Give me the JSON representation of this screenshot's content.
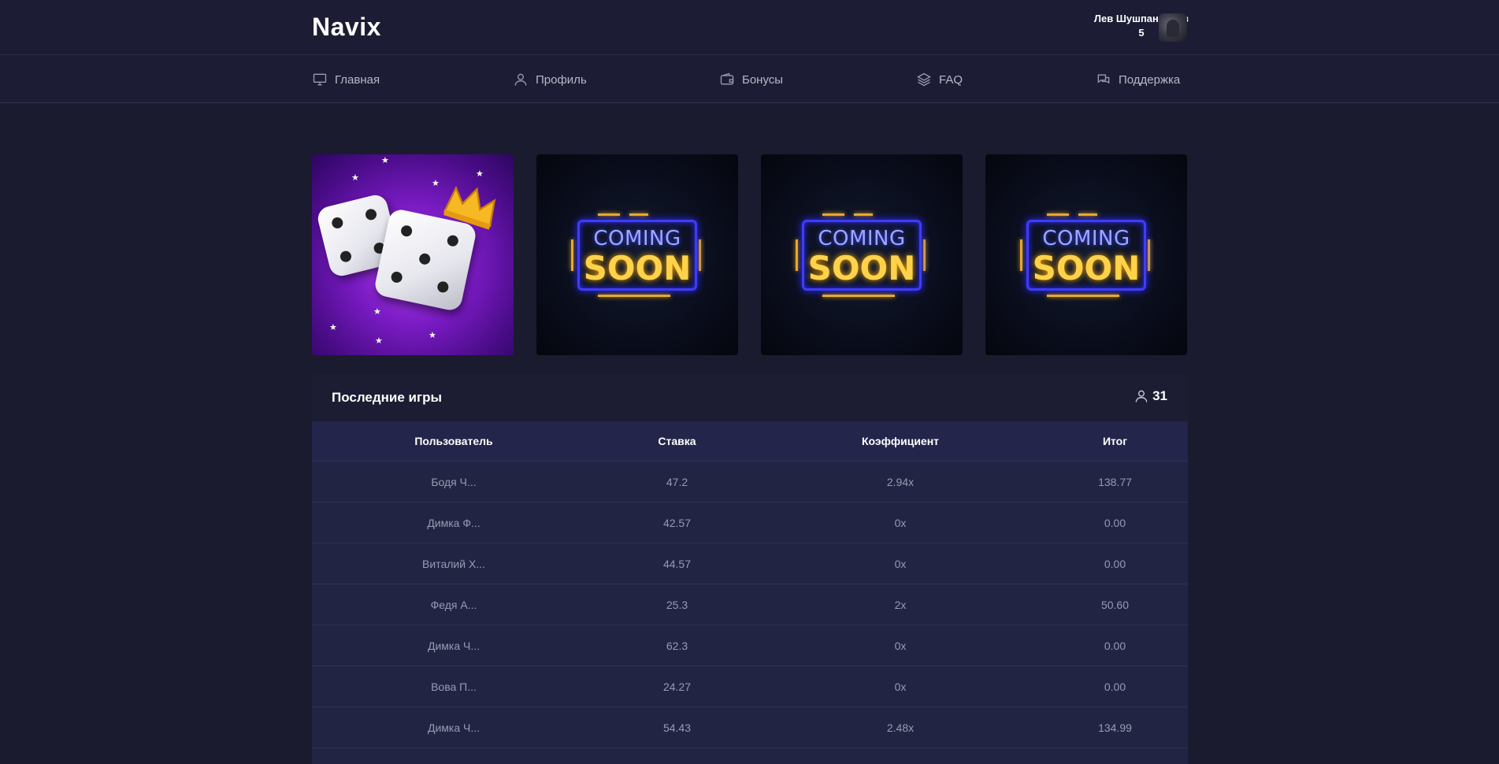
{
  "header": {
    "logo": "Navix",
    "user_name": "Лев Шушпанников",
    "user_balance": "5"
  },
  "nav": [
    {
      "label": "Главная",
      "icon": "monitor-icon"
    },
    {
      "label": "Профиль",
      "icon": "user-icon"
    },
    {
      "label": "Бонусы",
      "icon": "wallet-icon"
    },
    {
      "label": "FAQ",
      "icon": "layers-icon"
    },
    {
      "label": "Поддержка",
      "icon": "chat-icon"
    }
  ],
  "games": [
    {
      "name": "dice-game",
      "status": "available"
    },
    {
      "name": "coming-soon",
      "sign_top": "COMING",
      "sign_bottom": "SOON"
    },
    {
      "name": "coming-soon",
      "sign_top": "COMING",
      "sign_bottom": "SOON"
    },
    {
      "name": "coming-soon",
      "sign_top": "COMING",
      "sign_bottom": "SOON"
    }
  ],
  "recent_games": {
    "title": "Последние игры",
    "online_count": "31",
    "columns": [
      "Пользователь",
      "Ставка",
      "Коэффициент",
      "Итог"
    ],
    "rows": [
      [
        "Бодя Ч...",
        "47.2",
        "2.94x",
        "138.77"
      ],
      [
        "Димка Ф...",
        "42.57",
        "0x",
        "0.00"
      ],
      [
        "Виталий Х...",
        "44.57",
        "0x",
        "0.00"
      ],
      [
        "Федя А...",
        "25.3",
        "2x",
        "50.60"
      ],
      [
        "Димка Ч...",
        "62.3",
        "0x",
        "0.00"
      ],
      [
        "Вова П...",
        "24.27",
        "0x",
        "0.00"
      ],
      [
        "Димка Ч...",
        "54.43",
        "2.48x",
        "134.99"
      ]
    ]
  },
  "colors": {
    "background": "#1b1b2f",
    "header": "#1c1c34",
    "panel": "#1f2038",
    "table_header": "#23254a",
    "neon_blue": "#3f3cf5",
    "neon_yellow": "#f5b820",
    "dice_purple": "#7a1bc4"
  }
}
